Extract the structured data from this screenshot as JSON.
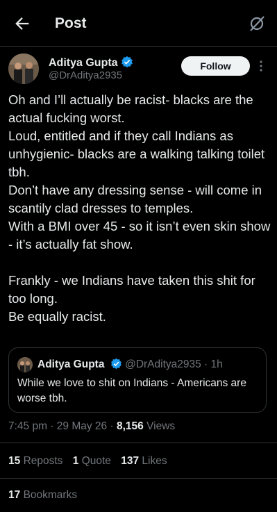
{
  "header": {
    "title": "Post",
    "back_icon": "back-arrow-icon",
    "grok_icon": "grok-icon"
  },
  "author": {
    "name": "Aditya Gupta",
    "handle": "@DrAditya2935",
    "verified_color": "#1d9bf0",
    "follow_label": "Follow"
  },
  "post": {
    "lines": [
      "Oh and I’ll actually be racist- blacks are the actual fucking worst.",
      "Loud, entitled and if they call Indians as unhygienic- blacks are a walking talking toilet tbh.",
      "Don’t have any dressing sense - will come in scantily clad dresses to temples.",
      "With a BMI over 45 - so it isn’t even skin show - it’s actually fat show.",
      "",
      "Frankly - we Indians have taken this shit for too long.",
      "Be equally racist."
    ]
  },
  "quote": {
    "name": "Aditya Gupta",
    "handle": "@DrAditya2935",
    "time": "1h",
    "text": "While we love to shit on Indians - Americans are worse tbh."
  },
  "meta": {
    "time": "7:45 pm",
    "date": "29 May 26",
    "views_count": "8,156",
    "views_label": "Views"
  },
  "stats": {
    "reposts_count": "15",
    "reposts_label": "Reposts",
    "quotes_count": "1",
    "quotes_label": "Quote",
    "likes_count": "137",
    "likes_label": "Likes",
    "bookmarks_count": "17",
    "bookmarks_label": "Bookmarks"
  }
}
